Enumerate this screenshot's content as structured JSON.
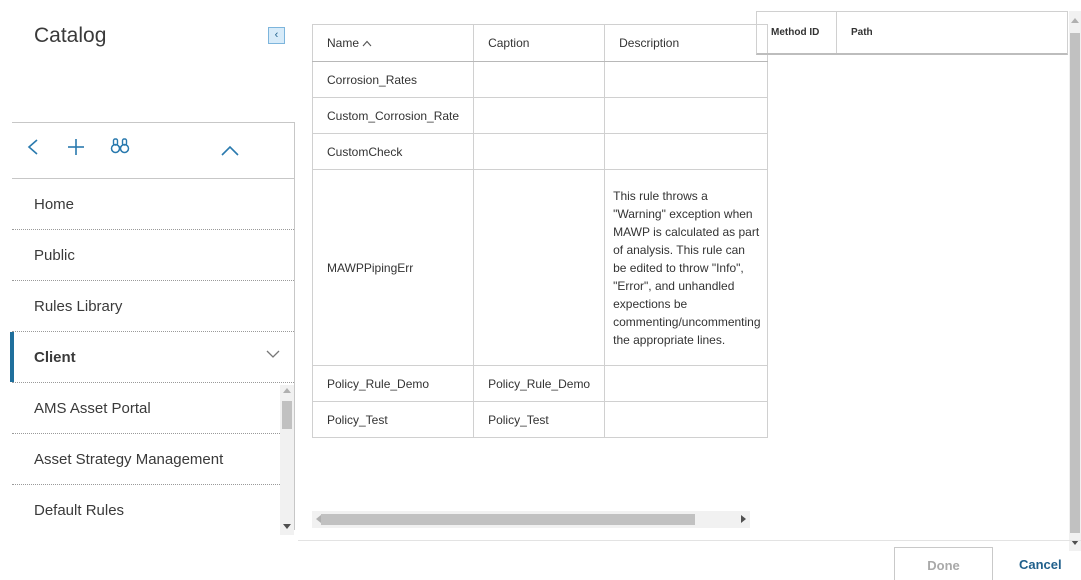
{
  "catalog": {
    "title": "Catalog",
    "collapse_glyph": "‹",
    "toolbar": {
      "back_icon": "chevron-left-icon",
      "add_icon": "plus-icon",
      "search_icon": "binoculars-icon",
      "collapse_icon": "chevron-up-icon"
    },
    "items": [
      {
        "label": "Home"
      },
      {
        "label": "Public"
      },
      {
        "label": "Rules Library"
      },
      {
        "label": "Client",
        "selected": true
      }
    ],
    "sub_items": [
      {
        "label": "AMS Asset Portal"
      },
      {
        "label": "Asset Strategy Management"
      },
      {
        "label": "Default Rules"
      }
    ]
  },
  "rules_table": {
    "columns": {
      "name": "Name",
      "caption": "Caption",
      "description": "Description"
    },
    "sort_indicator": "^",
    "rows": [
      {
        "name": "Corrosion_Rates",
        "caption": "",
        "description": ""
      },
      {
        "name": "Custom_Corrosion_Rate",
        "caption": "",
        "description": ""
      },
      {
        "name": "CustomCheck",
        "caption": "",
        "description": ""
      },
      {
        "name": "MAWPPipingErr",
        "caption": "",
        "description": "This rule throws a \"Warning\" exception when MAWP is calculated as part of analysis. This rule can be edited to throw \"Info\", \"Error\", and unhandled expections be commenting/uncommenting the appropriate lines."
      },
      {
        "name": "Policy_Rule_Demo",
        "caption": "Policy_Rule_Demo",
        "description": ""
      },
      {
        "name": "Policy_Test",
        "caption": "Policy_Test",
        "description": ""
      }
    ]
  },
  "methods_table": {
    "columns": {
      "method_id": "Method ID",
      "path": "Path"
    }
  },
  "footer": {
    "done_label": "Done",
    "cancel_label": "Cancel"
  },
  "colors": {
    "accent": "#1f6f9c",
    "link": "#1f5f8b",
    "icon": "#2a7aae"
  }
}
